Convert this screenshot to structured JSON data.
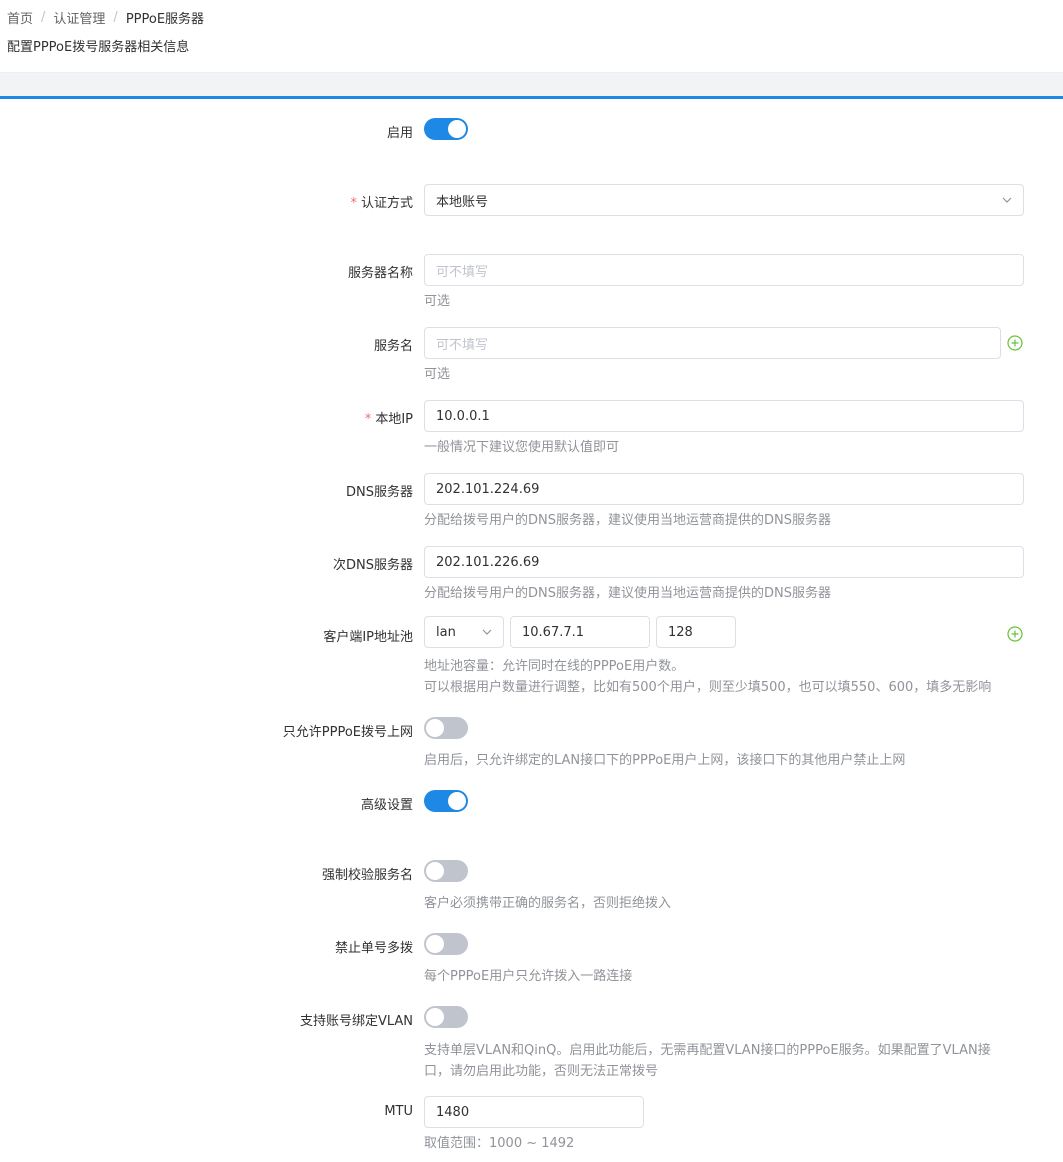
{
  "breadcrumb": {
    "home": "首页",
    "auth": "认证管理",
    "current": "PPPoE服务器",
    "sep": "/"
  },
  "page_desc": "配置PPPoE拨号服务器相关信息",
  "form": {
    "enable": {
      "label": "启用",
      "on": true
    },
    "auth_method": {
      "label": "认证方式",
      "value": "本地账号"
    },
    "server_name": {
      "label": "服务器名称",
      "placeholder": "可不填写",
      "hint": "可选"
    },
    "service_name": {
      "label": "服务名",
      "placeholder": "可不填写",
      "hint": "可选"
    },
    "local_ip": {
      "label": "本地IP",
      "value": "10.0.0.1",
      "hint": "一般情况下建议您使用默认值即可"
    },
    "dns": {
      "label": "DNS服务器",
      "value": "202.101.224.69",
      "hint": "分配给拨号用户的DNS服务器，建议使用当地运营商提供的DNS服务器"
    },
    "dns2": {
      "label": "次DNS服务器",
      "value": "202.101.226.69",
      "hint": "分配给拨号用户的DNS服务器，建议使用当地运营商提供的DNS服务器"
    },
    "pool": {
      "label": "客户端IP地址池",
      "iface": "lan",
      "start_ip": "10.67.7.1",
      "count": "128",
      "hint1": "地址池容量：允许同时在线的PPPoE用户数。",
      "hint2": "可以根据用户数量进行调整，比如有500个用户，则至少填500，也可以填550、600，填多无影响"
    },
    "pppoe_only": {
      "label": "只允许PPPoE拨号上网",
      "on": false,
      "hint": "启用后，只允许绑定的LAN接口下的PPPoE用户上网，该接口下的其他用户禁止上网"
    },
    "advanced": {
      "label": "高级设置",
      "on": true
    },
    "force_service": {
      "label": "强制校验服务名",
      "on": false,
      "hint": "客户必须携带正确的服务名，否则拒绝拨入"
    },
    "no_multi": {
      "label": "禁止单号多拨",
      "on": false,
      "hint": "每个PPPoE用户只允许拨入一路连接"
    },
    "vlan_bind": {
      "label": "支持账号绑定VLAN",
      "on": false,
      "hint1": "支持单层VLAN和QinQ。启用此功能后，无需再配置VLAN接口的PPPoE服务。如果配置了VLAN接",
      "hint2": "口，请勿启用此功能，否则无法正常拨号"
    },
    "mtu": {
      "label": "MTU",
      "value": "1480",
      "hint": "取值范围：1000 ~ 1492"
    }
  },
  "colors": {
    "accent": "#1e88e5",
    "add": "#67c23a",
    "required": "#f56c6c"
  }
}
